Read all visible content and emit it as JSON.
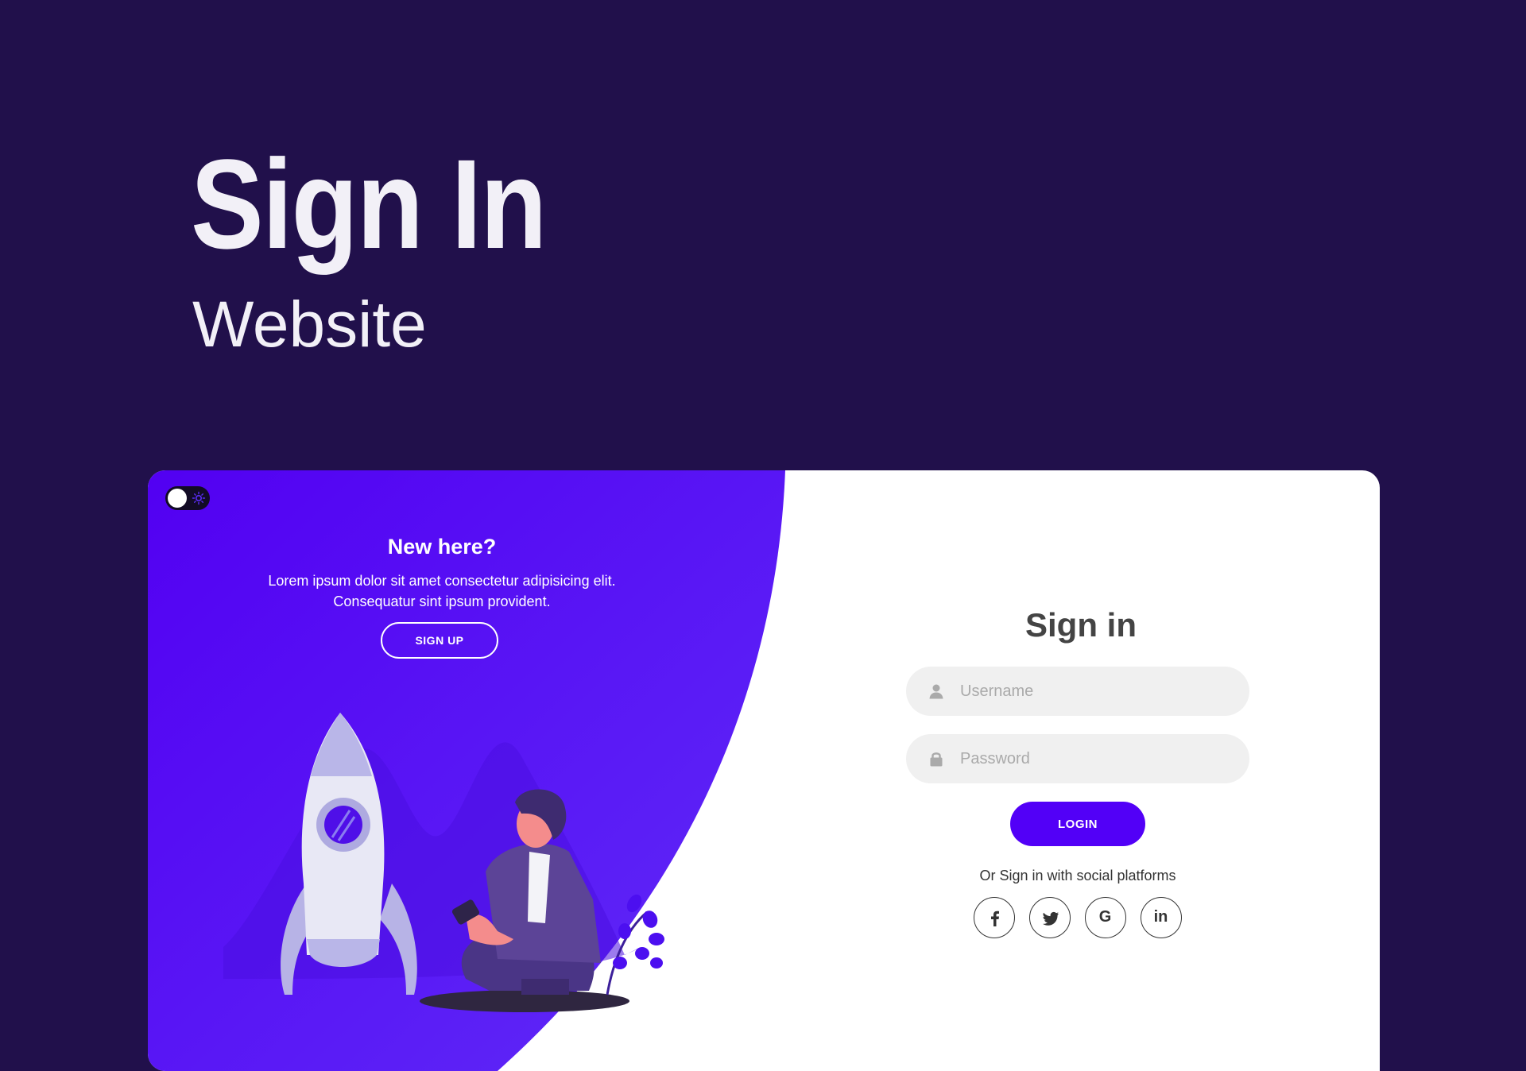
{
  "hero": {
    "title": "Sign In",
    "subtitle": "Website"
  },
  "colors": {
    "page_bg": "#21104b",
    "accent": "#5200f7",
    "card_bg": "#ffffff",
    "input_bg": "#f0f0f0"
  },
  "toggle": {
    "icon": "sun-icon"
  },
  "left_panel": {
    "heading": "New here?",
    "text": "Lorem ipsum dolor sit amet consectetur adipisicing elit. Consequatur sint ipsum provident.",
    "signup_label": "SIGN UP",
    "illustration": [
      "rocket-icon",
      "person-icon",
      "plant-icon"
    ]
  },
  "form": {
    "title": "Sign in",
    "username": {
      "placeholder": "Username",
      "value": "",
      "icon": "user-icon"
    },
    "password": {
      "placeholder": "Password",
      "value": "",
      "icon": "lock-icon"
    },
    "login_label": "LOGIN",
    "social_text": "Or Sign in with social platforms",
    "social": [
      {
        "name": "facebook",
        "icon": "facebook-icon"
      },
      {
        "name": "twitter",
        "icon": "twitter-icon"
      },
      {
        "name": "google",
        "icon": "google-icon",
        "glyph": "G"
      },
      {
        "name": "linkedin",
        "icon": "linkedin-icon",
        "glyph": "in"
      }
    ]
  }
}
